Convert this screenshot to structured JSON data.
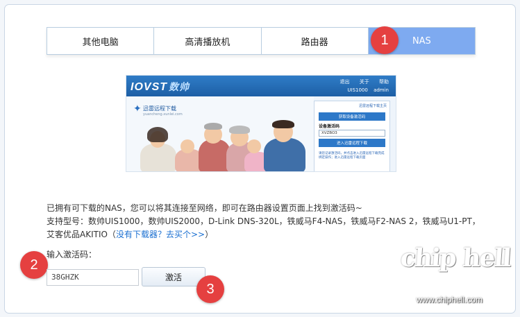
{
  "tabs": [
    {
      "label": "其他电脑",
      "active": false
    },
    {
      "label": "高清播放机",
      "active": false
    },
    {
      "label": "路由器",
      "active": false
    },
    {
      "label": "NAS",
      "active": true
    }
  ],
  "badges": [
    "1",
    "2",
    "3"
  ],
  "preview": {
    "logo": "IOVST",
    "logo_cn": "数帅",
    "user_row": [
      "退出",
      "关于",
      "帮助"
    ],
    "model": "UIS1000",
    "username": "admin",
    "brand": "迅雷远程下载",
    "brand_sub": "yuancheng.xunlei.com",
    "link": "迅雷远程下载主页",
    "get_code_button": "获取设备激活码",
    "code_label": "设备激活码",
    "code_value": "XVZBO3",
    "enter_button": "进入迅雷远程下载",
    "footer": "请您记录激活码，并点击进入迅雷远程下载完成绑定操作；进入迅雷远程下载页面"
  },
  "description": {
    "line1": "已拥有可下载的NAS，您可以将其连接至网络，即可在路由器设置页面上找到激活码~",
    "line2": "支持型号：数帅UIS1000，数帅UIS2000，D-Link DNS-320L，铁威马F4-NAS，铁威马F2-NAS 2，铁威马U1-PT，",
    "line3_prefix": "艾客优品AKITIO（",
    "line3_link": "没有下载器？去买个>>",
    "line3_suffix": "）"
  },
  "activation": {
    "label": "输入激活码：",
    "code": "38GHZK",
    "button": "激活"
  },
  "watermark": {
    "logo": "chip hell",
    "url": "www.chiphell.com"
  },
  "colors": {
    "active_tab": "#7eaaf0",
    "badge": "#e54040",
    "link": "#1a6fd1"
  }
}
